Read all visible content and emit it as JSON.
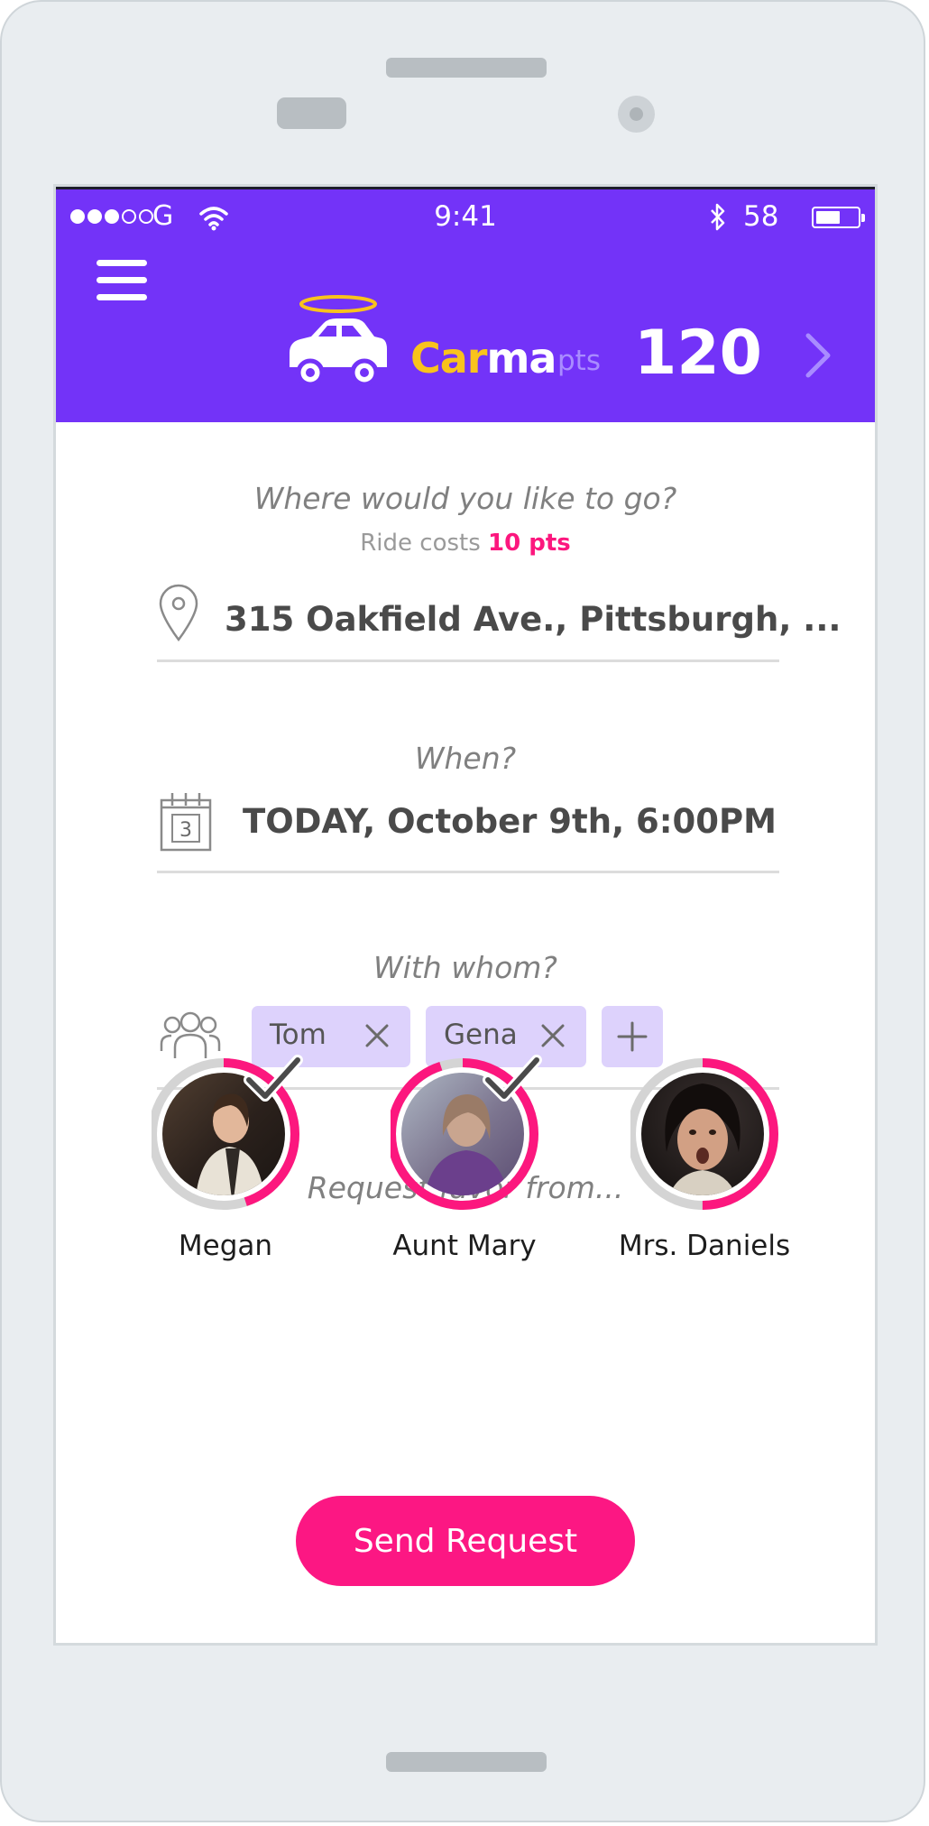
{
  "status_bar": {
    "carrier": "G",
    "time": "9:41",
    "battery_percent": "58",
    "battery_level": 0.58,
    "signal_filled": 3,
    "signal_total": 5
  },
  "header": {
    "brand_part1": "Car",
    "brand_part2": "ma",
    "points_label": "pts",
    "points": "120",
    "icons": {
      "menu": "hamburger-menu-icon",
      "car": "car-halo-icon",
      "next": "chevron-right-icon"
    }
  },
  "destination": {
    "prompt": "Where would you like to go?",
    "cost_label": "Ride costs",
    "cost_value": "10 pts",
    "address": "315 Oakfield Ave., Pittsburgh, ...",
    "icon": "map-pin-icon"
  },
  "when": {
    "prompt": "When?",
    "value": "TODAY, October 9th, 6:00PM",
    "calendar_day": "3",
    "icon": "calendar-icon"
  },
  "with_whom": {
    "prompt": "With whom?",
    "chips": [
      {
        "label": "Tom"
      },
      {
        "label": "Gena"
      }
    ],
    "icon": "group-icon",
    "add_icon": "plus-icon"
  },
  "favor": {
    "prompt": "Request favor from...",
    "people": [
      {
        "name": "Megan",
        "selected": true,
        "progress": 0.45
      },
      {
        "name": "Aunt Mary",
        "selected": true,
        "progress": 0.95
      },
      {
        "name": "Mrs. Daniels",
        "selected": false,
        "progress": 0.5
      }
    ]
  },
  "send_button": "Send Request",
  "colors": {
    "header_purple": "#7333f8",
    "accent_pink": "#fc1783",
    "brand_yellow": "#f9c31c",
    "chip_lavender": "#ddd2fc"
  }
}
